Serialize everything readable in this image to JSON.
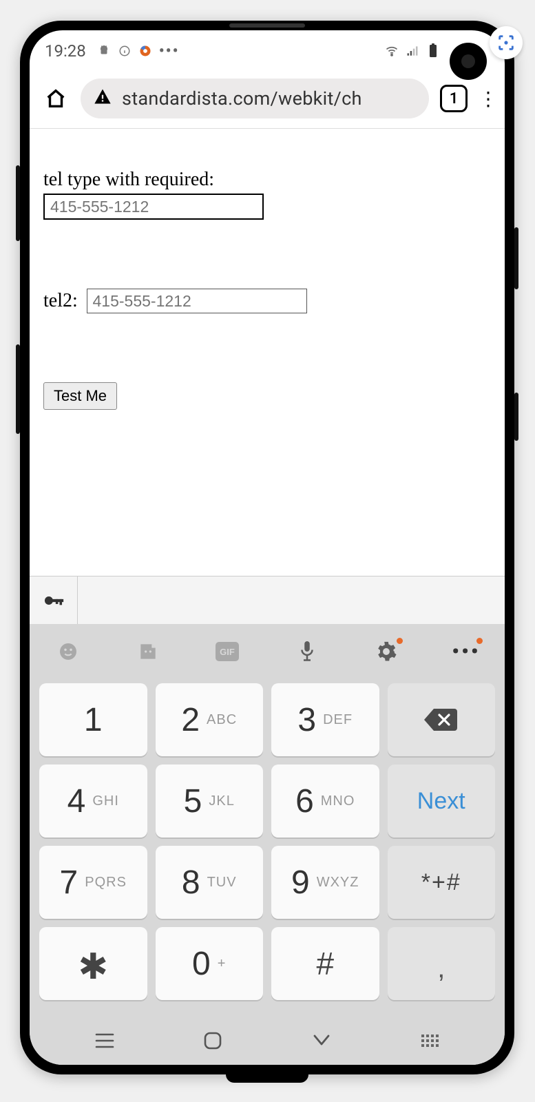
{
  "status": {
    "time": "19:28",
    "icons_left": [
      "android-icon",
      "info-icon",
      "browser-swirl-icon",
      "more-icon"
    ],
    "icons_right": [
      "wifi-icon",
      "signal-icon",
      "battery-icon"
    ]
  },
  "browser": {
    "url": "standardista.com/webkit/ch",
    "tab_count": "1"
  },
  "form": {
    "label1": "tel type with required:",
    "input1_placeholder": "415-555-1212",
    "label2": "tel2:",
    "input2_placeholder": "415-555-1212",
    "button_label": "Test Me"
  },
  "keyboard": {
    "toolbar": [
      "emoji-icon",
      "sticker-icon",
      "gif-icon",
      "mic-icon",
      "settings-icon",
      "more-icon"
    ],
    "keys": [
      {
        "d": "1",
        "l": ""
      },
      {
        "d": "2",
        "l": "ABC"
      },
      {
        "d": "3",
        "l": "DEF"
      },
      {
        "type": "backspace"
      },
      {
        "d": "4",
        "l": "GHI"
      },
      {
        "d": "5",
        "l": "JKL"
      },
      {
        "d": "6",
        "l": "MNO"
      },
      {
        "type": "next",
        "label": "Next"
      },
      {
        "d": "7",
        "l": "PQRS"
      },
      {
        "d": "8",
        "l": "TUV"
      },
      {
        "d": "9",
        "l": "WXYZ"
      },
      {
        "type": "sym",
        "label": "*+#"
      },
      {
        "type": "star",
        "label": "✱"
      },
      {
        "d": "0",
        "l": "+"
      },
      {
        "type": "hash",
        "label": "#"
      },
      {
        "type": "comma",
        "label": ","
      }
    ]
  },
  "nav": [
    "recent-apps",
    "home",
    "back",
    "keyboard-toggle"
  ]
}
